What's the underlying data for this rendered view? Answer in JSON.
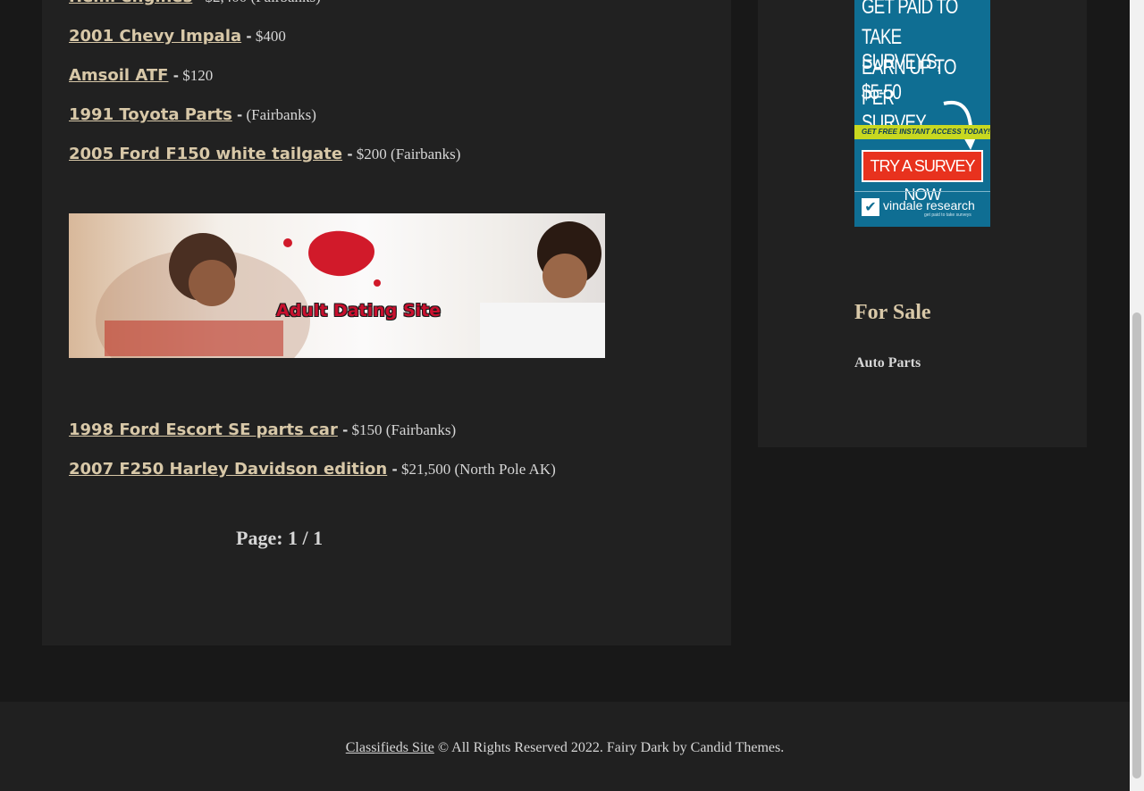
{
  "listings": [
    {
      "title": "2001 Chevy Impala",
      "detail": " $400"
    },
    {
      "title": "Amsoil ATF",
      "detail": " $120"
    },
    {
      "title": "1991 Toyota Parts",
      "detail": " (Fairbanks)"
    },
    {
      "title": "2005 Ford F150 white tailgate",
      "detail": " $200 (Fairbanks)"
    },
    {
      "title": "1998 Ford Escort SE parts car",
      "detail": " $150 (Fairbanks)"
    },
    {
      "title": "2007 F250 Harley Davidson edition",
      "detail": " $21,500 (North Pole AK)"
    }
  ],
  "separator": " -",
  "banner_ad": {
    "text": "Adult Dating Site"
  },
  "pager": "Page: 1 / 1",
  "survey_ad": {
    "lines": [
      "GET PAID TO",
      "TAKE SURVEYS,",
      "EARN UP TO $5-50",
      "PER SURVEY"
    ],
    "strip": "GET FREE INSTANT ACCESS TODAY!",
    "button": "TRY A SURVEY NOW",
    "brand": "vindale research",
    "tagline": "get paid to take surveys"
  },
  "sidebar": {
    "title": "For Sale",
    "link": "Auto Parts"
  },
  "footer": {
    "site_link": "Classifieds Site",
    "rest": " © All Rights Reserved 2022. Fairy Dark by Candid Themes."
  }
}
